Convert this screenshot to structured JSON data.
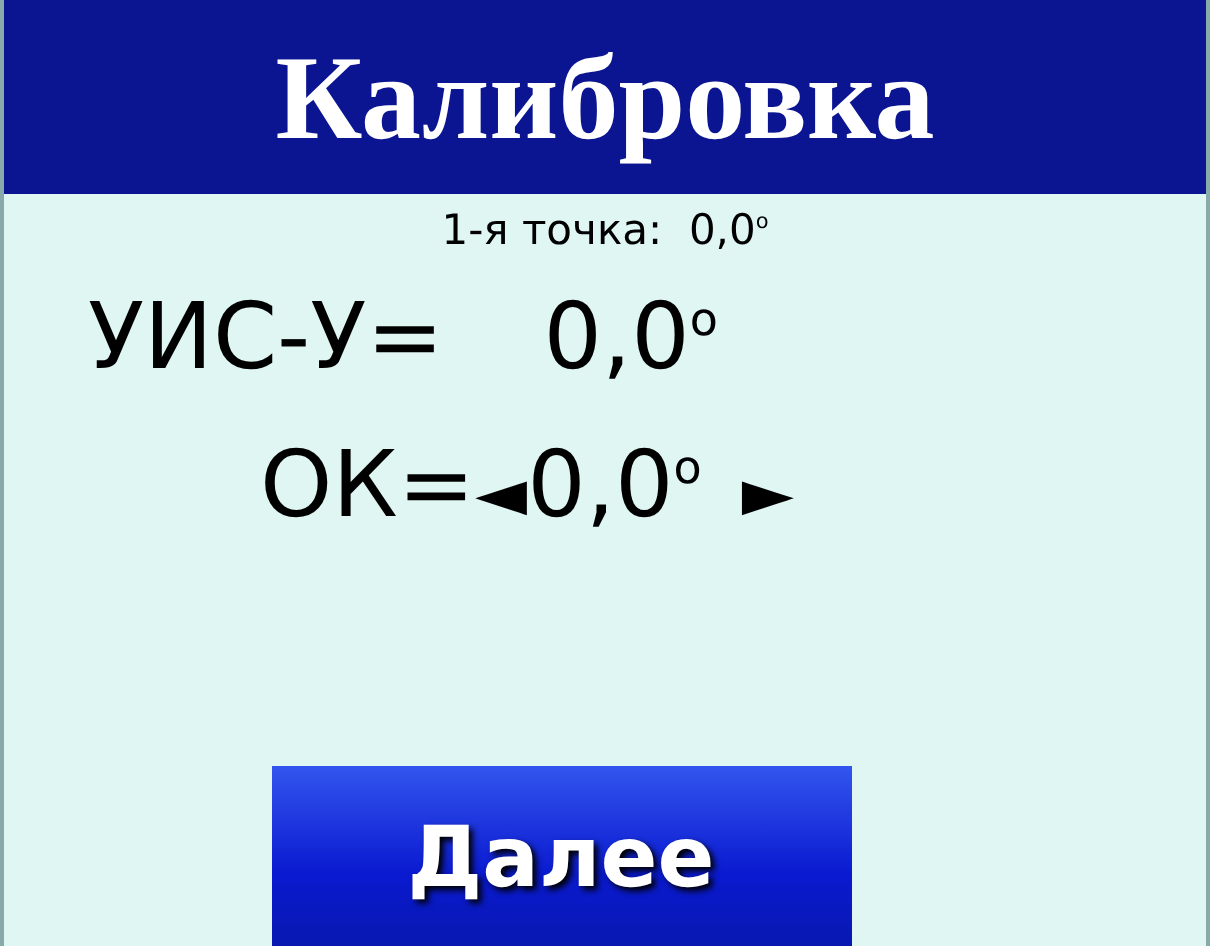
{
  "title": "Калибровка",
  "point": {
    "label": "1-я точка:",
    "value": "0,0$^{o}$"
  },
  "sensor": {
    "label": "УИС-У=",
    "value": "0,0$^{o}$"
  },
  "ok": {
    "label": "ОК=",
    "left_arrow": "◄",
    "value": "0,0$^{o}$",
    "right_arrow": "►"
  },
  "button": "Далее"
}
